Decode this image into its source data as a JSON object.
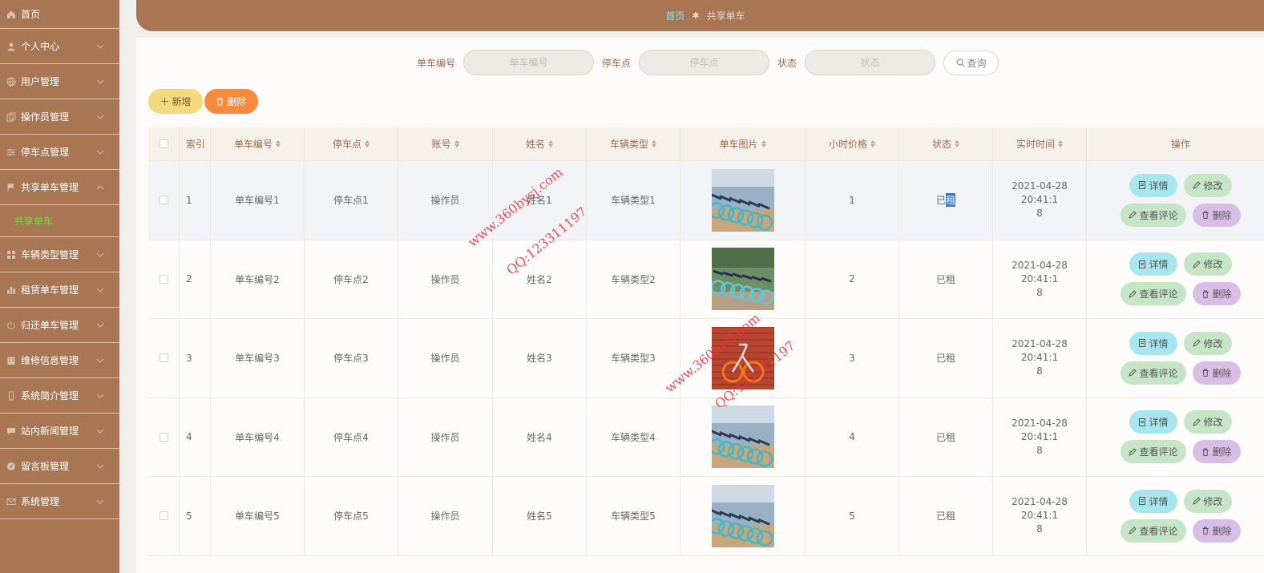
{
  "sidebar": {
    "items": [
      {
        "label": "首页",
        "icon": "home-icon"
      },
      {
        "label": "个人中心",
        "icon": "user-icon"
      },
      {
        "label": "用户管理",
        "icon": "globe-icon"
      },
      {
        "label": "操作员管理",
        "icon": "copy-icon"
      },
      {
        "label": "停车点管理",
        "icon": "sliders-icon"
      },
      {
        "label": "共享单车管理",
        "icon": "flag-icon"
      },
      {
        "label": "共享单车",
        "sub": true
      },
      {
        "label": "车辆类型管理",
        "icon": "grid-icon"
      },
      {
        "label": "租赁单车管理",
        "icon": "bar-chart-icon"
      },
      {
        "label": "归还单车管理",
        "icon": "power-icon"
      },
      {
        "label": "维修信息管理",
        "icon": "building-icon"
      },
      {
        "label": "系统简介管理",
        "icon": "phone-icon"
      },
      {
        "label": "站内新闻管理",
        "icon": "chat-icon"
      },
      {
        "label": "留言板管理",
        "icon": "compass-icon"
      },
      {
        "label": "系统管理",
        "icon": "mail-icon"
      }
    ]
  },
  "breadcrumb": {
    "home": "首页",
    "current": "共享单车"
  },
  "search": {
    "bike_no_label": "单车编号",
    "bike_no_placeholder": "单车编号",
    "park_label": "停车点",
    "park_placeholder": "停车点",
    "status_label": "状态",
    "status_placeholder": "状态",
    "query_label": "查询"
  },
  "actions": {
    "add_label": "新增",
    "delete_label": "删除"
  },
  "table": {
    "headers": [
      "索引",
      "单车编号",
      "停车点",
      "账号",
      "姓名",
      "车辆类型",
      "单车图片",
      "小时价格",
      "状态",
      "实时时间",
      "操作"
    ],
    "rows": [
      {
        "idx": "1",
        "bike_no": "单车编号1",
        "park": "停车点1",
        "account": "操作员",
        "name": "姓名1",
        "type": "车辆类型1",
        "price": "1",
        "status_a": "已",
        "status_b": "租",
        "time_a": "2021-04-28 20:41:1",
        "time_b": "8"
      },
      {
        "idx": "2",
        "bike_no": "单车编号2",
        "park": "停车点2",
        "account": "操作员",
        "name": "姓名2",
        "type": "车辆类型2",
        "price": "2",
        "status_a": "已租",
        "status_b": "",
        "time_a": "2021-04-28 20:41:1",
        "time_b": "8"
      },
      {
        "idx": "3",
        "bike_no": "单车编号3",
        "park": "停车点3",
        "account": "操作员",
        "name": "姓名3",
        "type": "车辆类型3",
        "price": "3",
        "status_a": "已租",
        "status_b": "",
        "time_a": "2021-04-28 20:41:1",
        "time_b": "8"
      },
      {
        "idx": "4",
        "bike_no": "单车编号4",
        "park": "停车点4",
        "account": "操作员",
        "name": "姓名4",
        "type": "车辆类型4",
        "price": "4",
        "status_a": "已租",
        "status_b": "",
        "time_a": "2021-04-28 20:41:1",
        "time_b": "8"
      },
      {
        "idx": "5",
        "bike_no": "单车编号5",
        "park": "停车点5",
        "account": "操作员",
        "name": "姓名5",
        "type": "车辆类型5",
        "price": "5",
        "status_a": "已租",
        "status_b": "",
        "time_a": "2021-04-28 20:41:1",
        "time_b": "8"
      }
    ],
    "row_ops": {
      "detail": "详情",
      "edit": "修改",
      "comment": "查看评论",
      "remove": "删除"
    }
  },
  "watermark": {
    "site": "www.360bysj.com",
    "qq": "QQ:123311197"
  },
  "colors": {
    "sidebar": "#a87652",
    "active_sub": "#7fd34b",
    "breadcrumb_home": "#7fe6ff",
    "add_btn": "#f3d97b",
    "delete_btn": "#f78a3f"
  }
}
